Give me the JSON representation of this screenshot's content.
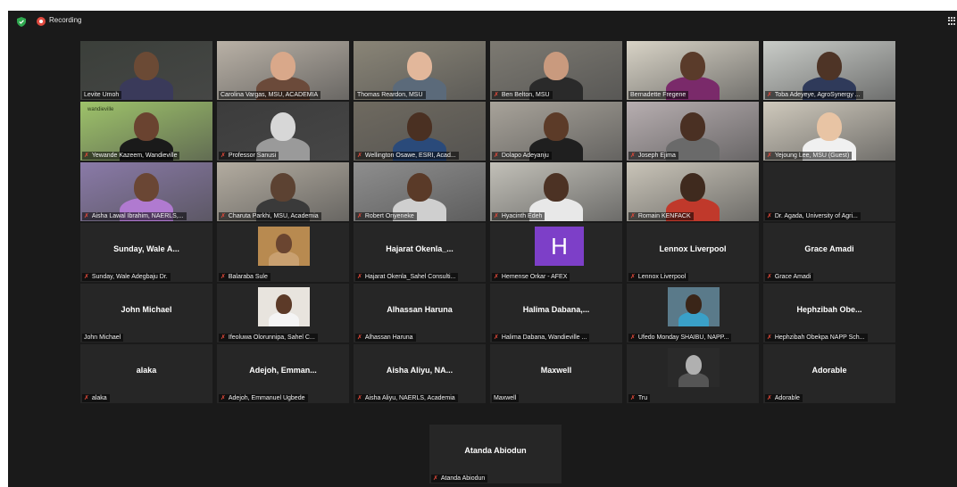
{
  "topbar": {
    "recording_label": "Recording"
  },
  "participants": [
    {
      "name": "Levite Umoh",
      "muted": false,
      "type": "video",
      "active": true,
      "bg": "#3b3f3a",
      "skin": "#6b4a35",
      "shirt": "#3a3a5a"
    },
    {
      "name": "Carolina Vargas, MSU, ACADEMIA",
      "muted": false,
      "type": "video",
      "bg": "#b9b1a6",
      "skin": "#d9a88a",
      "shirt": "#6b4a3a"
    },
    {
      "name": "Thomas Reardon, MSU",
      "muted": false,
      "type": "video",
      "bg": "#8a8577",
      "skin": "#e2b79b",
      "shirt": "#5b6a7a"
    },
    {
      "name": "Ben Belton, MSU",
      "muted": true,
      "type": "video",
      "bg": "#7d7a72",
      "skin": "#c99a7e",
      "shirt": "#2a2a2a"
    },
    {
      "name": "Bernadette Fregene",
      "muted": false,
      "type": "video",
      "bg": "#d8d3c6",
      "skin": "#5a3b2a",
      "shirt": "#7a2a6a"
    },
    {
      "name": "Toba Adeyeye, AgroSynergy ...",
      "muted": true,
      "type": "video",
      "bg": "#c9ccc8",
      "skin": "#4e3426",
      "shirt": "#2f3a5a"
    },
    {
      "name": "Yewande Kazeem, Wandieville",
      "muted": true,
      "type": "video",
      "bg": "#9ec36a",
      "skin": "#6a4330",
      "shirt": "#1a1a1a",
      "brand": "wandieville"
    },
    {
      "name": "Professor Sanusi",
      "muted": true,
      "type": "video",
      "bg": "#3c3c3c",
      "skin": "#d7d7d7",
      "shirt": "#9a9a9a"
    },
    {
      "name": "Wellington Osawe, ESRI, Acad...",
      "muted": true,
      "type": "video",
      "bg": "#6f6a60",
      "skin": "#4a3022",
      "shirt": "#2a4a7a"
    },
    {
      "name": "Dolapo Adeyanju",
      "muted": true,
      "type": "video",
      "bg": "#a8a39a",
      "skin": "#5c3b28",
      "shirt": "#1f1f1f"
    },
    {
      "name": "Joseph Ejima",
      "muted": true,
      "type": "video",
      "bg": "#b7aeb0",
      "skin": "#4a3023",
      "shirt": "#6a6a6a"
    },
    {
      "name": "Yejoung Lee, MSU (Guest)",
      "muted": true,
      "type": "video",
      "bg": "#cfc9bc",
      "skin": "#e8c4a4",
      "shirt": "#f0f0f0"
    },
    {
      "name": "Aisha Lawal Ibrahim, NAERLS,...",
      "muted": true,
      "type": "video",
      "bg": "#8a7aa8",
      "skin": "#6a4634",
      "shirt": "#b07ad0"
    },
    {
      "name": "Charuta Parkhi, MSU, Academia",
      "muted": true,
      "type": "video",
      "bg": "#b3aca0",
      "skin": "#5c4232",
      "shirt": "#3a3a3a"
    },
    {
      "name": "Robert Onyeneke",
      "muted": true,
      "type": "video",
      "bg": "#8e8e8e",
      "skin": "#5a3a28",
      "shirt": "#cfcfcf"
    },
    {
      "name": "Hyacinth Edeh",
      "muted": true,
      "type": "video",
      "bg": "#c2c0b8",
      "skin": "#4c3224",
      "shirt": "#e8e8e8"
    },
    {
      "name": "Romain KENFACK",
      "muted": true,
      "type": "video",
      "bg": "#c9c4b8",
      "skin": "#3f2a1e",
      "shirt": "#c0392b"
    },
    {
      "name": "Dr. Agada,  University of Agri...",
      "muted": true,
      "type": "blank"
    },
    {
      "name": "Sunday, Wale Adegbaju Dr.",
      "display": "Sunday, Wale A...",
      "muted": true,
      "type": "name"
    },
    {
      "name": "Balaraba Sule",
      "muted": true,
      "type": "photo",
      "bg": "#b88a50",
      "skin": "#6a4530",
      "shirt": "#c9a070"
    },
    {
      "name": "Hajarat Okenla_Sahel Consulti...",
      "display": "Hajarat  Okenla_...",
      "muted": true,
      "type": "name"
    },
    {
      "name": "Hemense Orkar - AFEX",
      "muted": true,
      "type": "letter",
      "letter": "H"
    },
    {
      "name": "Lennox Liverpool",
      "display": "Lennox Liverpool",
      "muted": true,
      "type": "name"
    },
    {
      "name": "Grace Amadi",
      "display": "Grace Amadi",
      "muted": true,
      "type": "name"
    },
    {
      "name": "John Michael",
      "display": "John Michael",
      "muted": false,
      "type": "name"
    },
    {
      "name": "Ifeoluwa Olorunnipa, Sahel C...",
      "muted": true,
      "type": "photo",
      "bg": "#e8e4de",
      "skin": "#5c3a28",
      "shirt": "#f4f4f4"
    },
    {
      "name": "Alhassan Haruna",
      "display": "Alhassan Haruna",
      "muted": true,
      "type": "name"
    },
    {
      "name": "Halima Dabana, Wandieville ...",
      "display": "Halima  Dabana,...",
      "muted": true,
      "type": "name"
    },
    {
      "name": "Ufedo Monday SHAIBU, NAPP...",
      "muted": true,
      "type": "photo",
      "bg": "#5a7a8a",
      "skin": "#3a2518",
      "shirt": "#3aa0c8"
    },
    {
      "name": "Hephzibah Obekpa NAPP Sch...",
      "display": "Hephzibah  Obe...",
      "muted": true,
      "type": "name"
    },
    {
      "name": "alaka",
      "display": "alaka",
      "muted": true,
      "type": "name"
    },
    {
      "name": "Adejoh, Emmanuel Ugbede",
      "display": "Adejoh,  Emman...",
      "muted": true,
      "type": "name"
    },
    {
      "name": "Aisha Aliyu, NAERLS, Academia",
      "display": "Aisha  Aliyu,  NA...",
      "muted": true,
      "type": "name"
    },
    {
      "name": "Maxwell",
      "display": "Maxwell",
      "muted": false,
      "type": "name"
    },
    {
      "name": "Tru",
      "muted": true,
      "type": "photo",
      "bg": "#2a2a2a",
      "skin": "#b0b0b0",
      "shirt": "#555555"
    },
    {
      "name": "Adorable",
      "display": "Adorable",
      "muted": true,
      "type": "name"
    }
  ],
  "last": {
    "name": "Atanda Abiodun",
    "display": "Atanda Abiodun",
    "muted": true,
    "type": "name"
  }
}
